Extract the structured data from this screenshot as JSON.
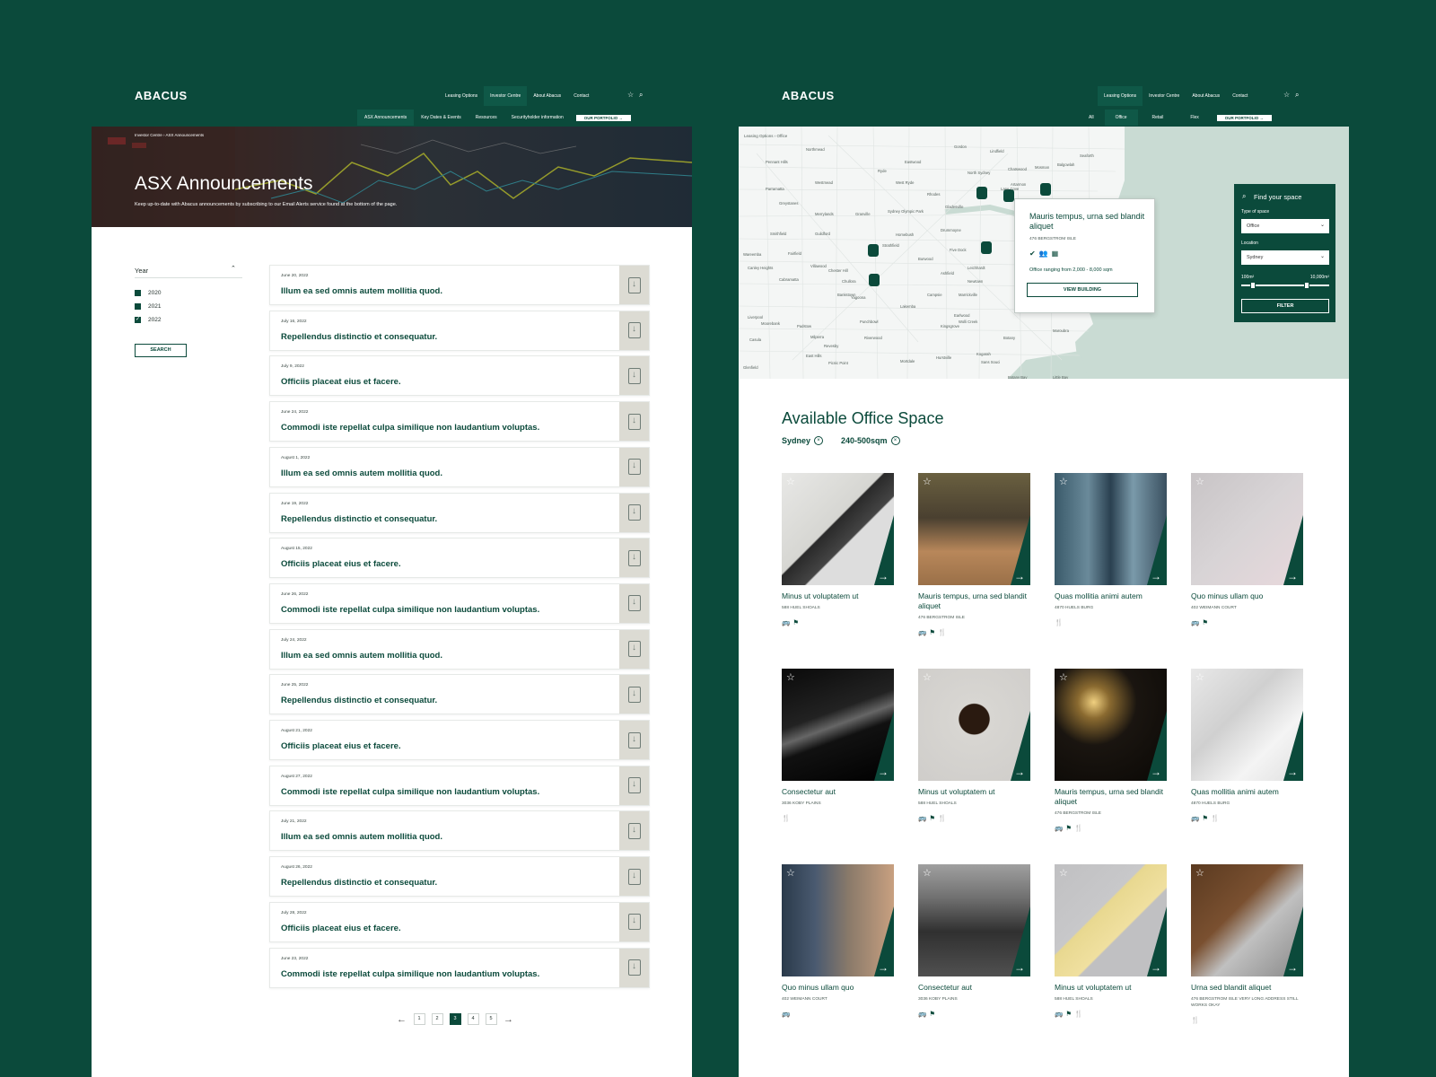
{
  "left": {
    "logo": "ABACUS",
    "nav": [
      "Leasing Options",
      "Investor Centre",
      "About Abacus",
      "Contact"
    ],
    "nav_active": "Investor Centre",
    "subnav": [
      "ASX Announcements",
      "Key Dates & Events",
      "Resources",
      "Securityholder information"
    ],
    "subnav_active": "ASX Announcements",
    "portfolio_btn": "OUR PORTFOLIO",
    "breadcrumb": [
      "Investor Centre",
      "ASX Announcements"
    ],
    "hero_title": "ASX Announcements",
    "hero_sub": "Keep up-to-date with Abacus announcements by subscribing to our Email Alerts service found at the bottom of the page.",
    "filter": {
      "title": "Year",
      "years": [
        {
          "label": "2020",
          "checked": false
        },
        {
          "label": "2021",
          "checked": false
        },
        {
          "label": "2022",
          "checked": true
        }
      ],
      "search": "SEARCH"
    },
    "announcements": [
      {
        "date": "June 20, 2022",
        "title": "Illum ea sed omnis autem mollitia quod."
      },
      {
        "date": "July 16, 2022",
        "title": "Repellendus distinctio et consequatur."
      },
      {
        "date": "July 9, 2022",
        "title": "Officiis placeat eius et facere."
      },
      {
        "date": "June 24, 2022",
        "title": "Commodi iste repellat culpa similique non laudantium voluptas."
      },
      {
        "date": "August 1, 2022",
        "title": "Illum ea sed omnis autem mollitia quod."
      },
      {
        "date": "June 19, 2022",
        "title": "Repellendus distinctio et consequatur."
      },
      {
        "date": "August 15, 2022",
        "title": "Officiis placeat eius et facere."
      },
      {
        "date": "June 26, 2022",
        "title": "Commodi iste repellat culpa similique non laudantium voluptas."
      },
      {
        "date": "July 24, 2022",
        "title": "Illum ea sed omnis autem mollitia quod."
      },
      {
        "date": "June 25, 2022",
        "title": "Repellendus distinctio et consequatur."
      },
      {
        "date": "August 21, 2022",
        "title": "Officiis placeat eius et facere."
      },
      {
        "date": "August 27, 2022",
        "title": "Commodi iste repellat culpa similique non laudantium voluptas."
      },
      {
        "date": "July 21, 2022",
        "title": "Illum ea sed omnis autem mollitia quod."
      },
      {
        "date": "August 26, 2022",
        "title": "Repellendus distinctio et consequatur."
      },
      {
        "date": "July 28, 2022",
        "title": "Officiis placeat eius et facere."
      },
      {
        "date": "June 23, 2022",
        "title": "Commodi iste repellat culpa similique non laudantium voluptas."
      }
    ],
    "pages": [
      "1",
      "2",
      "3",
      "4",
      "5"
    ],
    "current_page": "3"
  },
  "right": {
    "logo": "ABACUS",
    "nav": [
      "Leasing Options",
      "Investor Centre",
      "About Abacus",
      "Contact"
    ],
    "nav_active": "Leasing Options",
    "subnav": [
      "All",
      "Office",
      "Retail",
      "Flex"
    ],
    "subnav_active": "Office",
    "portfolio_btn": "OUR PORTFOLIO",
    "breadcrumb": [
      "Leasing Options",
      "Office"
    ],
    "map_labels": [
      "Northmead",
      "Eastwood",
      "Lindfield",
      "Gordon",
      "Pennant Hills",
      "West Ryde",
      "Chatswood",
      "Mosman",
      "Balgowlah",
      "Seaforth",
      "Parramatta",
      "Greystanes",
      "Westmead",
      "Ryde",
      "Artarmon",
      "Lane Cove",
      "North Sydney",
      "Merrylands",
      "Granville",
      "Sydney Olympic Park",
      "Rhodes",
      "Drummoyne",
      "Gladesville",
      "Smithfield",
      "Guildford",
      "Homebush",
      "Strathfield",
      "Five Dock",
      "Fairfield",
      "Villawood",
      "Chester Hill",
      "Burwood",
      "Ashfield",
      "Leichhardt",
      "Newtown",
      "Cabramatta",
      "Bankstown",
      "Campsie",
      "Marrickville",
      "Canley Heights",
      "Chullora",
      "Earlwood",
      "Liverpool",
      "Moorebank",
      "Padstow",
      "Punchbowl",
      "Lakemba",
      "Wolli Creek",
      "Casula",
      "Milperra",
      "Revesby",
      "Riverwood",
      "Kogarah",
      "Botany",
      "Maroubra",
      "East Hills",
      "Picnic Point",
      "Mortdale",
      "Hurstville",
      "Sans Souci",
      "Botany Bay",
      "Little Bay",
      "Glenfield",
      "Yagoona",
      "Wareemba",
      "Kingsgrove"
    ],
    "popup": {
      "title": "Mauris tempus, urna sed blandit aliquet",
      "address": "476 BERGSTROM ISLE",
      "range": "Office ranging from 2,000 - 8,000 sqm",
      "button": "VIEW BUILDING"
    },
    "finder": {
      "title": "Find your space",
      "type_label": "Type of space",
      "type_value": "Office",
      "location_label": "Location",
      "location_value": "Sydney",
      "range_min": "100m²",
      "range_max": "10,000m²",
      "button": "FILTER"
    },
    "heading": "Available Office Space",
    "chips": [
      "Sydney",
      "240-500sqm"
    ],
    "cards": [
      {
        "title": "Minus ut voluptatem ut",
        "address": "588 HUEL SHOALS",
        "amenities": "🚌⚑"
      },
      {
        "title": "Mauris tempus, urna sed blandit aliquet",
        "address": "476 BERGSTROM ISLE",
        "amenities": "🚌⚑🍴"
      },
      {
        "title": "Quas mollitia animi autem",
        "address": "4870 HUELS BURG",
        "amenities": "🍴"
      },
      {
        "title": "Quo minus ullam quo",
        "address": "402 WEIMANN COURT",
        "amenities": "🚌⚑"
      },
      {
        "title": "Consectetur aut",
        "address": "3036 KOBY PLAINS",
        "amenities": "🍴"
      },
      {
        "title": "Minus ut voluptatem ut",
        "address": "588 HUEL SHOALS",
        "amenities": "🚌⚑🍴"
      },
      {
        "title": "Mauris tempus, urna sed blandit aliquet",
        "address": "476 BERGSTROM ISLE",
        "amenities": "🚌⚑🍴"
      },
      {
        "title": "Quas mollitia animi autem",
        "address": "4870 HUELS BURG",
        "amenities": "🚌⚑🍴"
      },
      {
        "title": "Quo minus ullam quo",
        "address": "402 WEIMANN COURT",
        "amenities": "🚌"
      },
      {
        "title": "Consectetur aut",
        "address": "3036 KOBY PLAINS",
        "amenities": "🚌⚑"
      },
      {
        "title": "Minus ut voluptatem ut",
        "address": "588 HUEL SHOALS",
        "amenities": "🚌⚑🍴"
      },
      {
        "title": "Urna sed blandit aliquet",
        "address": "476 BERGSTROM ISLE VERY LONG ADDRESS STILL WORKS OKAY",
        "amenities": "🍴"
      }
    ]
  }
}
